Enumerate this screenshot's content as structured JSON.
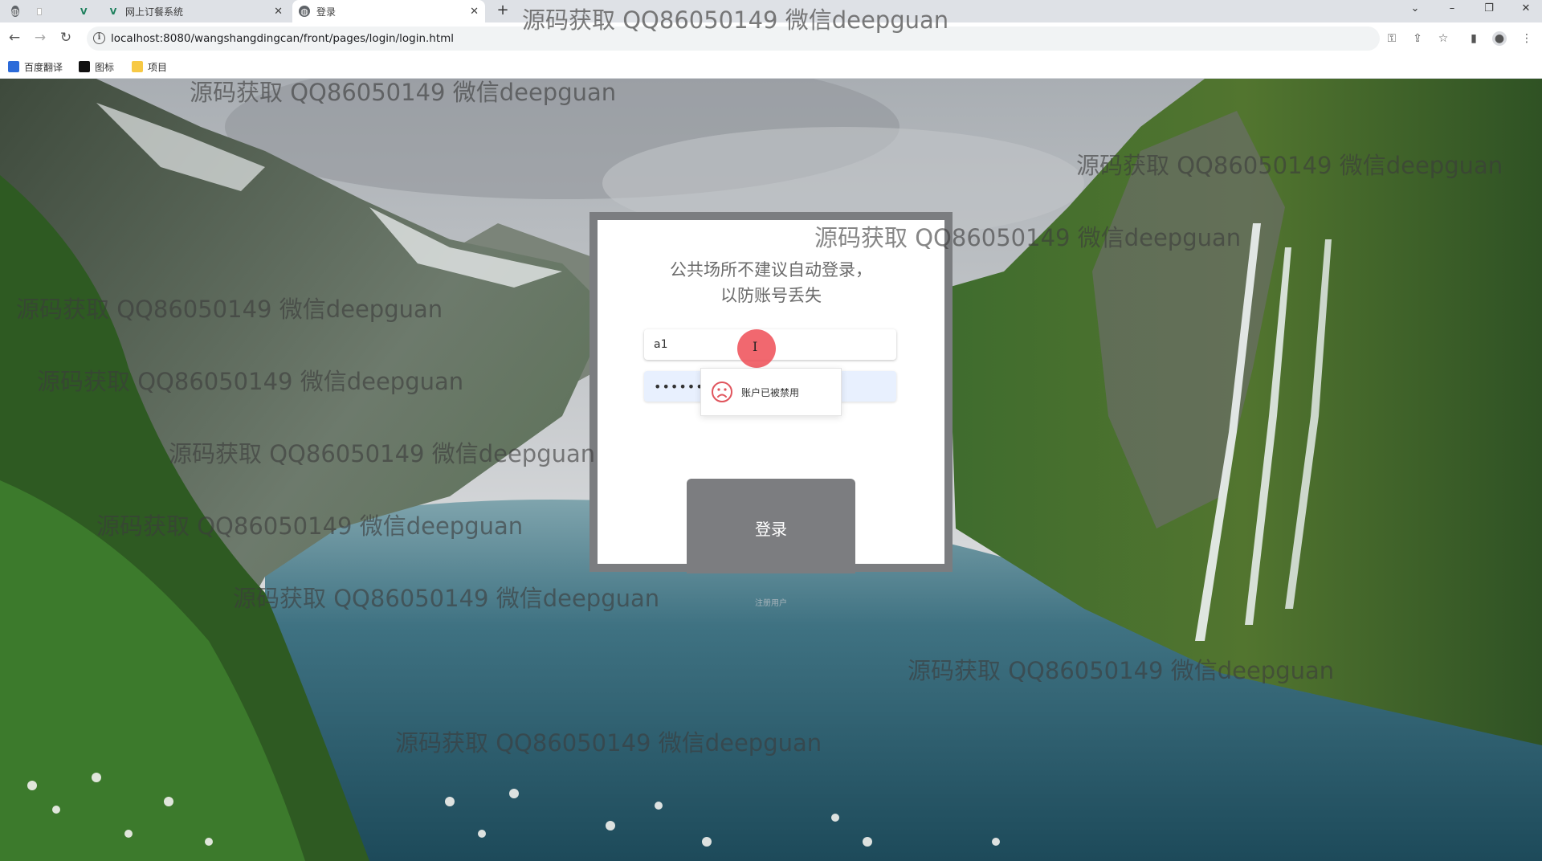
{
  "browser": {
    "tabs": [
      {
        "label": "",
        "icon": "globe-icon"
      },
      {
        "label": "",
        "icon": "blank-page-icon"
      },
      {
        "label": "",
        "icon": "v-logo-icon"
      },
      {
        "label": "网上订餐系统",
        "icon": "v-logo-icon"
      },
      {
        "label": "登录",
        "icon": "globe-icon",
        "active": true
      }
    ],
    "new_tab": "+",
    "url": "localhost:8080/wangshangdingcan/front/pages/login/login.html",
    "bookmarks": [
      {
        "label": "百度翻译",
        "icon": "baidu-translate-icon"
      },
      {
        "label": "图标",
        "icon": "bookmark-black-icon"
      },
      {
        "label": "项目",
        "icon": "folder-icon"
      }
    ]
  },
  "login": {
    "notice_line1": "公共场所不建议自动登录，",
    "notice_line2": "以防账号丢失",
    "username": "a1",
    "password_masked": "••••••",
    "toast_message": "账户已被禁用",
    "submit_label": "登录",
    "register_label": "注册用户"
  },
  "watermark": {
    "text": "源码获取 QQ86050149 微信deepguan"
  },
  "colors": {
    "modal_frame": "#7b7d80",
    "button": "#7c7d80",
    "autofill": "#e8f0fe",
    "cursor_highlight": "#ee4e56"
  }
}
